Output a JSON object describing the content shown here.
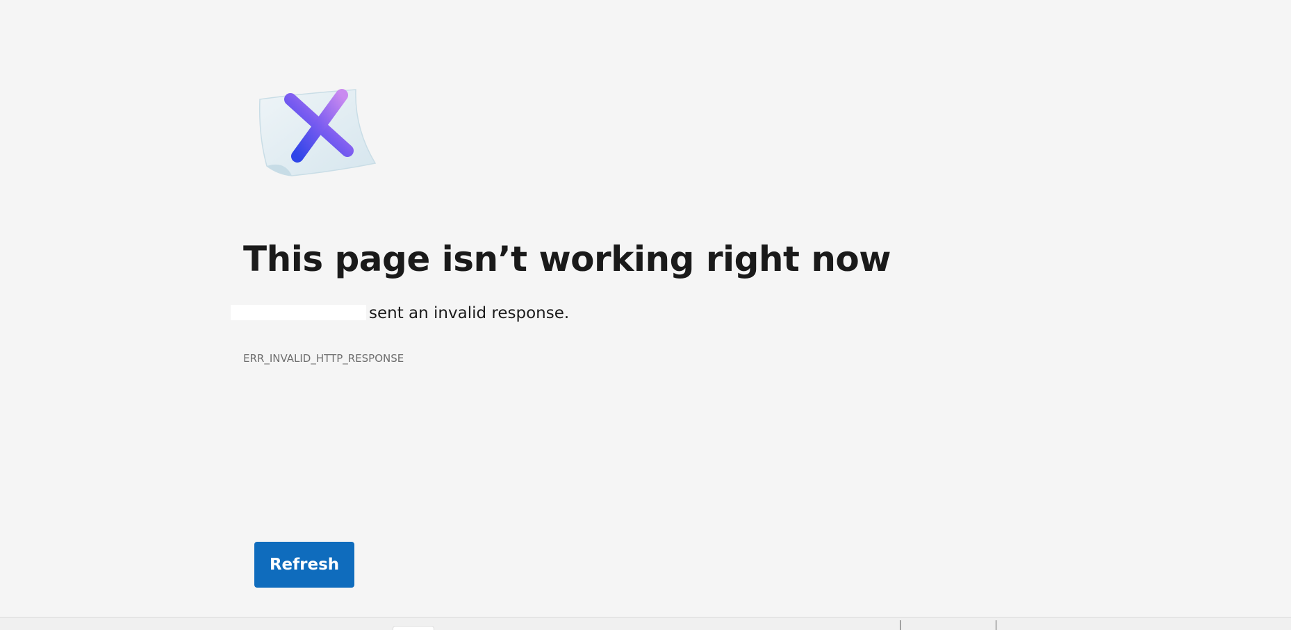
{
  "error_page": {
    "icon": "error-x-document-icon",
    "title": "This page isn’t working right now",
    "message_suffix": "sent an invalid response.",
    "error_code": "ERR_INVALID_HTTP_RESPONSE",
    "refresh_label": "Refresh"
  },
  "colors": {
    "background": "#f5f5f5",
    "accent": "#0f6cbd",
    "icon_gradient_start": "#b57ee8",
    "icon_gradient_end": "#3346e6"
  }
}
